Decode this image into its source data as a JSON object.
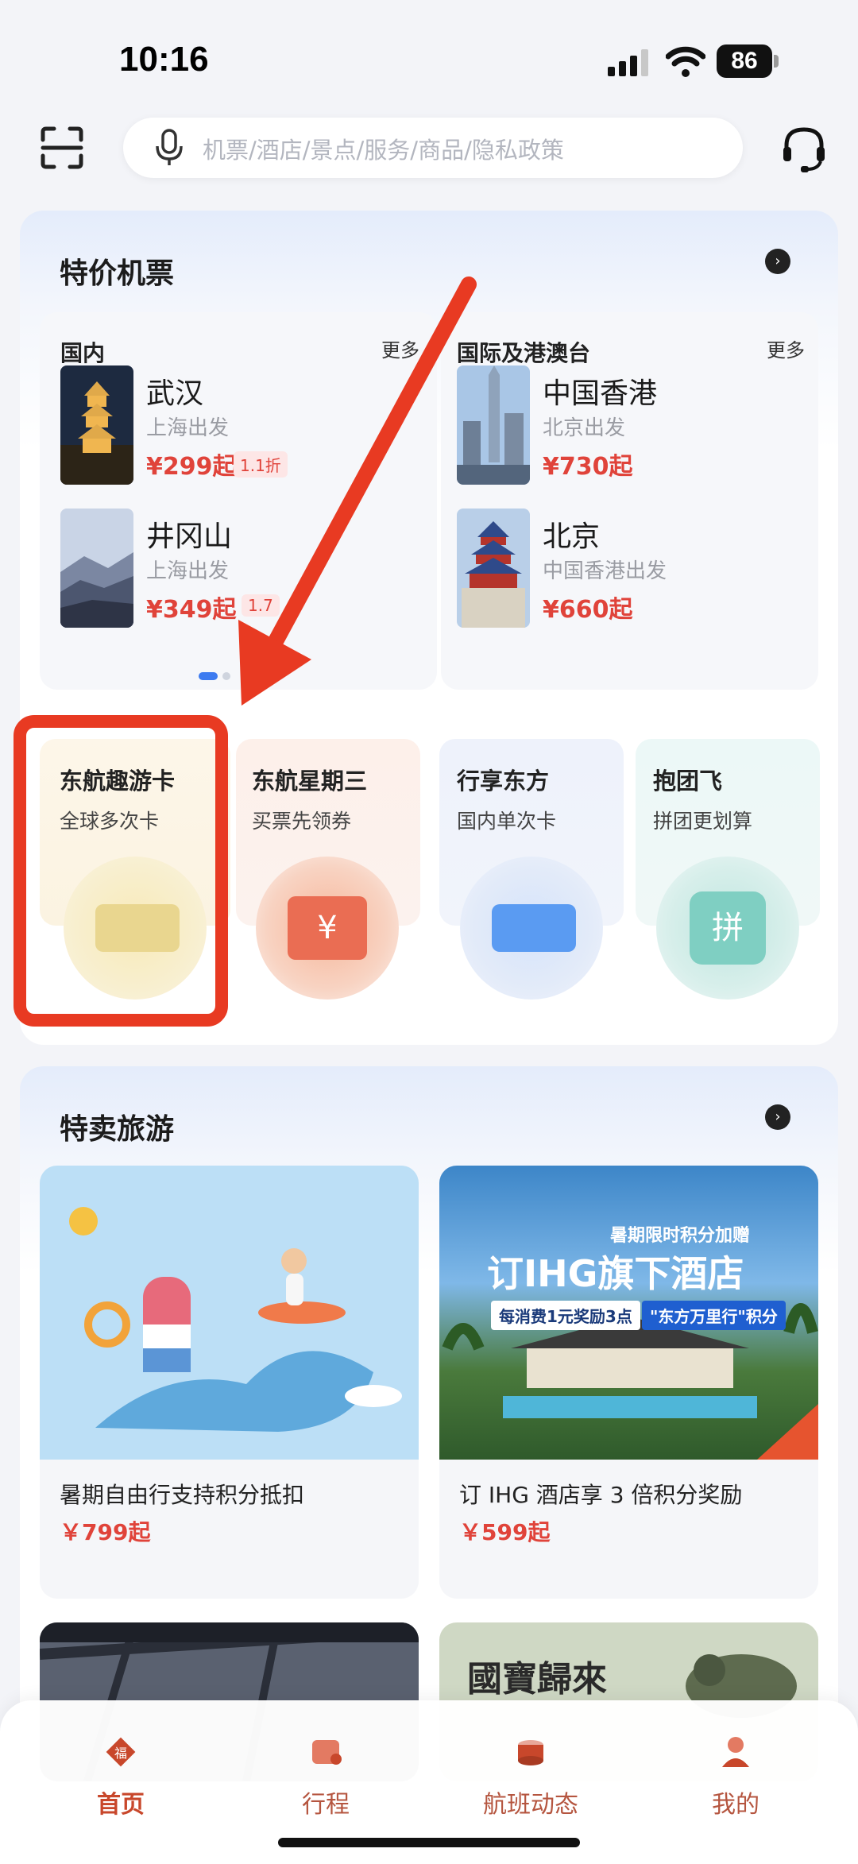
{
  "status_bar": {
    "time": "10:16",
    "battery": "86"
  },
  "search": {
    "placeholder": "机票/酒店/景点/服务/商品/隐私政策"
  },
  "flights": {
    "title": "特价机票",
    "domestic": {
      "title": "国内",
      "more": "更多",
      "items": [
        {
          "city": "武汉",
          "from": "上海出发",
          "price": "¥299起",
          "badge": "1.1折"
        },
        {
          "city": "井冈山",
          "from": "上海出发",
          "price": "¥349起",
          "badge": "1.7"
        }
      ]
    },
    "international": {
      "title": "国际及港澳台",
      "more": "更多",
      "items": [
        {
          "city": "中国香港",
          "from": "北京出发",
          "price": "¥730起"
        },
        {
          "city": "北京",
          "from": "中国香港出发",
          "price": "¥660起"
        }
      ]
    },
    "promos": [
      {
        "title": "东航趣游卡",
        "subtitle": "全球多次卡",
        "icon": "card-icon"
      },
      {
        "title": "东航星期三",
        "subtitle": "买票先领券",
        "icon": "ticket-icon",
        "glyph": "¥"
      },
      {
        "title": "行享东方",
        "subtitle": "国内单次卡",
        "icon": "card-icon"
      },
      {
        "title": "抱团飞",
        "subtitle": "拼团更划算",
        "icon": "group-icon",
        "glyph": "拼"
      }
    ]
  },
  "tours": {
    "title": "特卖旅游",
    "items": [
      {
        "title": "暑期自由行支持积分抵扣",
        "price": "￥799起"
      },
      {
        "title": "订 IHG 酒店享 3 倍积分奖励",
        "price": "￥599起"
      }
    ],
    "ihg_banner": {
      "line1": "暑期限时积分加赠",
      "headline": "订IHG旗下酒店",
      "line3": "每消费1元奖励3点",
      "tag": "\"东方万里行\"积分"
    },
    "third_banner": {
      "text": "國寶歸來"
    }
  },
  "bottom_nav": [
    {
      "label": "首页",
      "active": true
    },
    {
      "label": "行程",
      "active": false
    },
    {
      "label": "航班动态",
      "active": false
    },
    {
      "label": "我的",
      "active": false
    }
  ],
  "colors": {
    "price": "#e0433a",
    "highlight": "#e83a22",
    "nav_active": "#c8472b"
  }
}
